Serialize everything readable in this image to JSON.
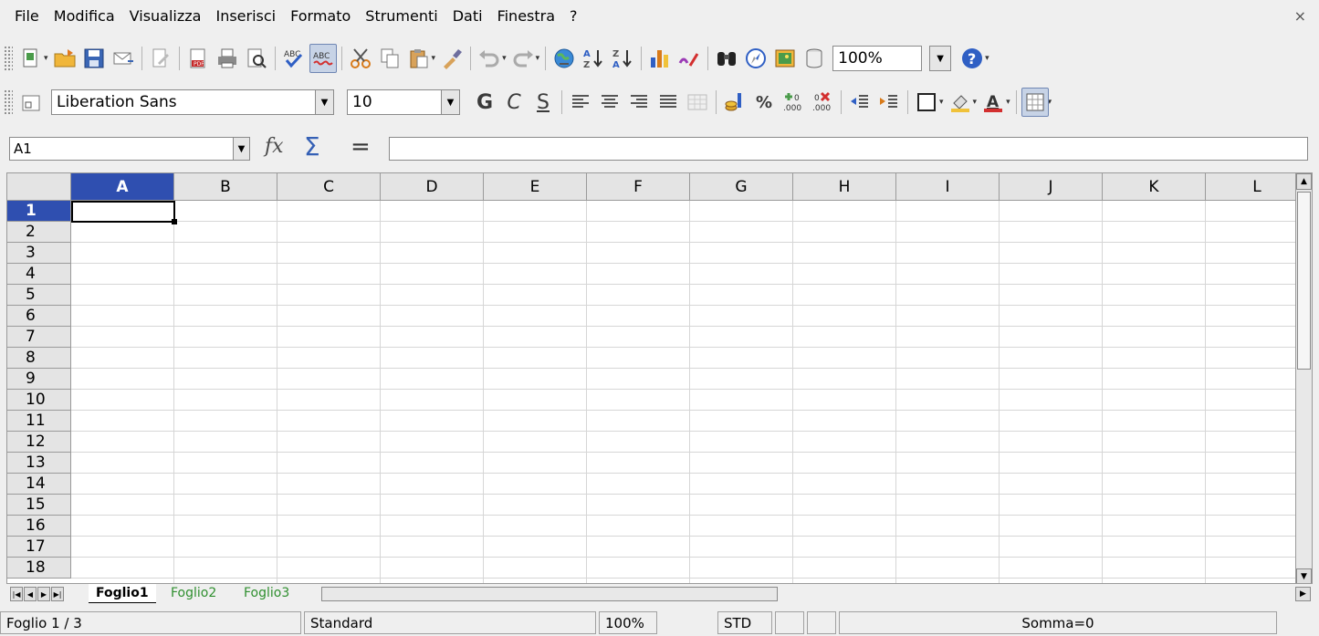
{
  "menu": {
    "items": [
      {
        "label": "File"
      },
      {
        "label": "Modifica"
      },
      {
        "label": "Visualizza"
      },
      {
        "label": "Inserisci"
      },
      {
        "label": "Formato"
      },
      {
        "label": "Strumenti"
      },
      {
        "label": "Dati"
      },
      {
        "label": "Finestra"
      },
      {
        "label": "?"
      }
    ],
    "close_glyph": "×"
  },
  "toolbar1": {
    "zoom_value": "100%"
  },
  "toolbar2": {
    "font_name": "Liberation Sans",
    "font_size": "10",
    "bold_label": "G",
    "italic_label": "C",
    "underline_label": "S",
    "percent_label": "%"
  },
  "formula": {
    "cell_ref": "A1",
    "fx_label": "fx",
    "sigma_label": "Σ",
    "equals_label": "=",
    "content": ""
  },
  "grid": {
    "columns": [
      "A",
      "B",
      "C",
      "D",
      "E",
      "F",
      "G",
      "H",
      "I",
      "J",
      "K",
      "L"
    ],
    "rows": [
      "1",
      "2",
      "3",
      "4",
      "5",
      "6",
      "7",
      "8",
      "9",
      "10",
      "11",
      "12",
      "13",
      "14",
      "15",
      "16",
      "17",
      "18"
    ],
    "selected_col": "A",
    "selected_row": "1"
  },
  "sheets": {
    "tabs": [
      "Foglio1",
      "Foglio2",
      "Foglio3"
    ],
    "active": "Foglio1"
  },
  "status": {
    "sheet_pos": "Foglio 1 / 3",
    "style": "Standard",
    "zoom": "100%",
    "mode": "STD",
    "sum": "Somma=0"
  },
  "colors": {
    "selection_header": "#2f4fb0",
    "sheet_inactive": "#2f8f2f",
    "help_icon": "#2f5fc4"
  }
}
